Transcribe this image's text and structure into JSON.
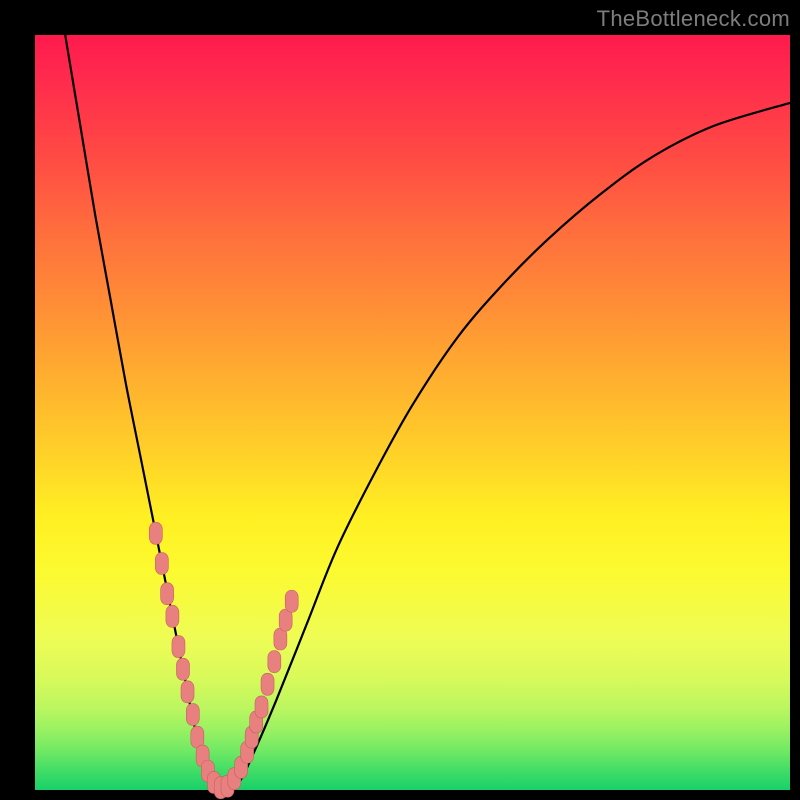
{
  "watermark": "TheBottleneck.com",
  "colors": {
    "frame": "#000000",
    "gradient_top": "#ff1a4d",
    "gradient_mid": "#ffd328",
    "gradient_bottom": "#18d06a",
    "curve": "#000000",
    "marker_fill": "#e98080",
    "marker_stroke": "#c46060"
  },
  "chart_data": {
    "type": "line",
    "title": "",
    "xlabel": "",
    "ylabel": "",
    "xlim": [
      0,
      100
    ],
    "ylim": [
      0,
      100
    ],
    "series": [
      {
        "name": "bottleneck-curve",
        "x": [
          4,
          6,
          8,
          10,
          12,
          14,
          16,
          18,
          20,
          21,
          22,
          23,
          24,
          25,
          27,
          29,
          32,
          36,
          40,
          45,
          50,
          56,
          62,
          68,
          75,
          82,
          90,
          100
        ],
        "y": [
          100,
          88,
          76,
          65,
          54,
          44,
          34,
          24,
          14,
          9,
          5,
          2,
          0.5,
          0,
          1,
          5,
          12,
          22,
          32,
          42,
          51,
          60,
          67,
          73,
          79,
          84,
          88,
          91
        ]
      }
    ],
    "markers": {
      "name": "sample-points",
      "points": [
        {
          "x": 16.0,
          "y": 34
        },
        {
          "x": 16.8,
          "y": 30
        },
        {
          "x": 17.5,
          "y": 26
        },
        {
          "x": 18.2,
          "y": 23
        },
        {
          "x": 19.0,
          "y": 19
        },
        {
          "x": 19.6,
          "y": 16
        },
        {
          "x": 20.2,
          "y": 13
        },
        {
          "x": 20.9,
          "y": 10
        },
        {
          "x": 21.5,
          "y": 7
        },
        {
          "x": 22.2,
          "y": 4.5
        },
        {
          "x": 22.9,
          "y": 2.5
        },
        {
          "x": 23.7,
          "y": 1
        },
        {
          "x": 24.6,
          "y": 0.3
        },
        {
          "x": 25.5,
          "y": 0.5
        },
        {
          "x": 26.4,
          "y": 1.5
        },
        {
          "x": 27.3,
          "y": 3
        },
        {
          "x": 28.1,
          "y": 5
        },
        {
          "x": 28.7,
          "y": 7
        },
        {
          "x": 29.3,
          "y": 9
        },
        {
          "x": 30.0,
          "y": 11
        },
        {
          "x": 30.8,
          "y": 14
        },
        {
          "x": 31.7,
          "y": 17
        },
        {
          "x": 32.5,
          "y": 20
        },
        {
          "x": 33.2,
          "y": 22.5
        },
        {
          "x": 34.0,
          "y": 25
        }
      ]
    }
  }
}
